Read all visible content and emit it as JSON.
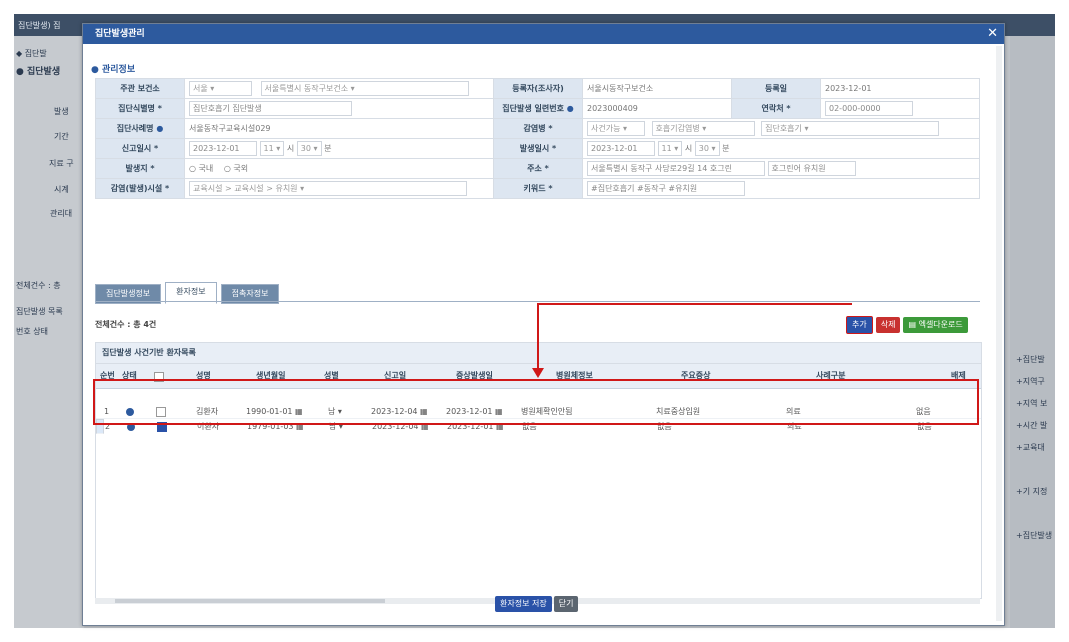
{
  "background": {
    "title": "집단발생) 집",
    "side_items": [
      "◆ 집단발",
      "● 집단발생",
      "발생",
      "기간",
      "지료 구",
      "시계",
      "관리대",
      "전체건수 : 총",
      "집단발생 목록",
      "번호 상태"
    ],
    "right_items": [
      "+집단발",
      "+지역구",
      "+지역 보",
      "+시간 발",
      "+교육대",
      "+기 지정",
      "+집단발생"
    ]
  },
  "dialog": {
    "title": "집단발생관리",
    "close_icon": "close-icon",
    "section_title": "● 관리정보",
    "form": {
      "health_center_label": "주관 보건소",
      "health_center_value": "서울",
      "health_center_sub": "서울특별시 동작구보건소",
      "registrar_label": "등록자(조사자)",
      "registrar_value": "서울시동작구보건소",
      "reg_date_label": "등록일",
      "reg_date_value": "2023-12-01",
      "case_name_label": "집단식별명 *",
      "case_name_value": "집단호흡기 집단발생",
      "case_no_label": "집단발생 일련번호",
      "case_no_value": "2023000409",
      "contact_label": "연락처 *",
      "contact_value": "02-000-0000",
      "case_type_label": "집단사례명",
      "case_type_value": "서울동작구교육시설029",
      "infection_label": "감염병 *",
      "infection_sel1": "사건가능",
      "infection_sel2": "호흡기감염병",
      "infection_sel3": "집단호흡기",
      "report_date_label": "신고일시 *",
      "report_date_value": "2023-12-01",
      "report_hour": "11",
      "report_min": "30",
      "report_unit1": "시",
      "report_unit2": "분",
      "occur_date_label": "발생일시 *",
      "occur_date_value": "2023-12-01",
      "occur_hour": "11",
      "occur_min": "30",
      "reporter_label": "발생지 *",
      "reporter_opt1": "국내",
      "reporter_opt2": "국외",
      "address_label": "주소 *",
      "address_value": "서울특별시 동작구 사당로29길 14 호그린",
      "address_detail": "호그린어 유치원",
      "facility_label": "감염(발생)시설 *",
      "facility_value": "교육시설 > 교육시설 > 유치원",
      "keyword_label": "키워드 *",
      "keyword_value": "#집단호흡기 #동작구 #유치원"
    },
    "tabs": [
      "집단발생정보",
      "환자정보",
      "접촉자정보"
    ],
    "count_text": "전체건수 : 총 4건",
    "buttons": {
      "add": "추가",
      "delete": "삭제",
      "excel": "엑셀다운로드"
    },
    "grid": {
      "caption": "집단발생 사건기반 환자목록",
      "headers": [
        "순번",
        "상태",
        "",
        "성명",
        "생년월일",
        "성별",
        "신고일",
        "증상발생일",
        "병원체정보",
        "주요증상",
        "사례구분",
        "배제"
      ],
      "rows": [
        {
          "no": "1",
          "name": "김환자",
          "birth": "1990-01-01",
          "sex": "남",
          "report": "2023-12-04",
          "onset": "2023-12-01",
          "pathogen": "병원체확인안됨",
          "symptom": "치료중상입원",
          "case": "의료",
          "excl": "없음"
        },
        {
          "no": "2",
          "name": "이환자",
          "birth": "1979-01-03",
          "sex": "남",
          "report": "2023-12-04",
          "onset": "2023-12-01",
          "pathogen": "없음",
          "symptom": "없음",
          "case": "의료",
          "excl": "없음"
        }
      ]
    },
    "footer": {
      "save": "환자정보 저장",
      "close": "닫기"
    }
  },
  "colors": {
    "header_blue": "#2d5a9e",
    "highlight_red": "#d01818",
    "excel_green": "#3c9a3a",
    "delete_red": "#c8312f"
  }
}
